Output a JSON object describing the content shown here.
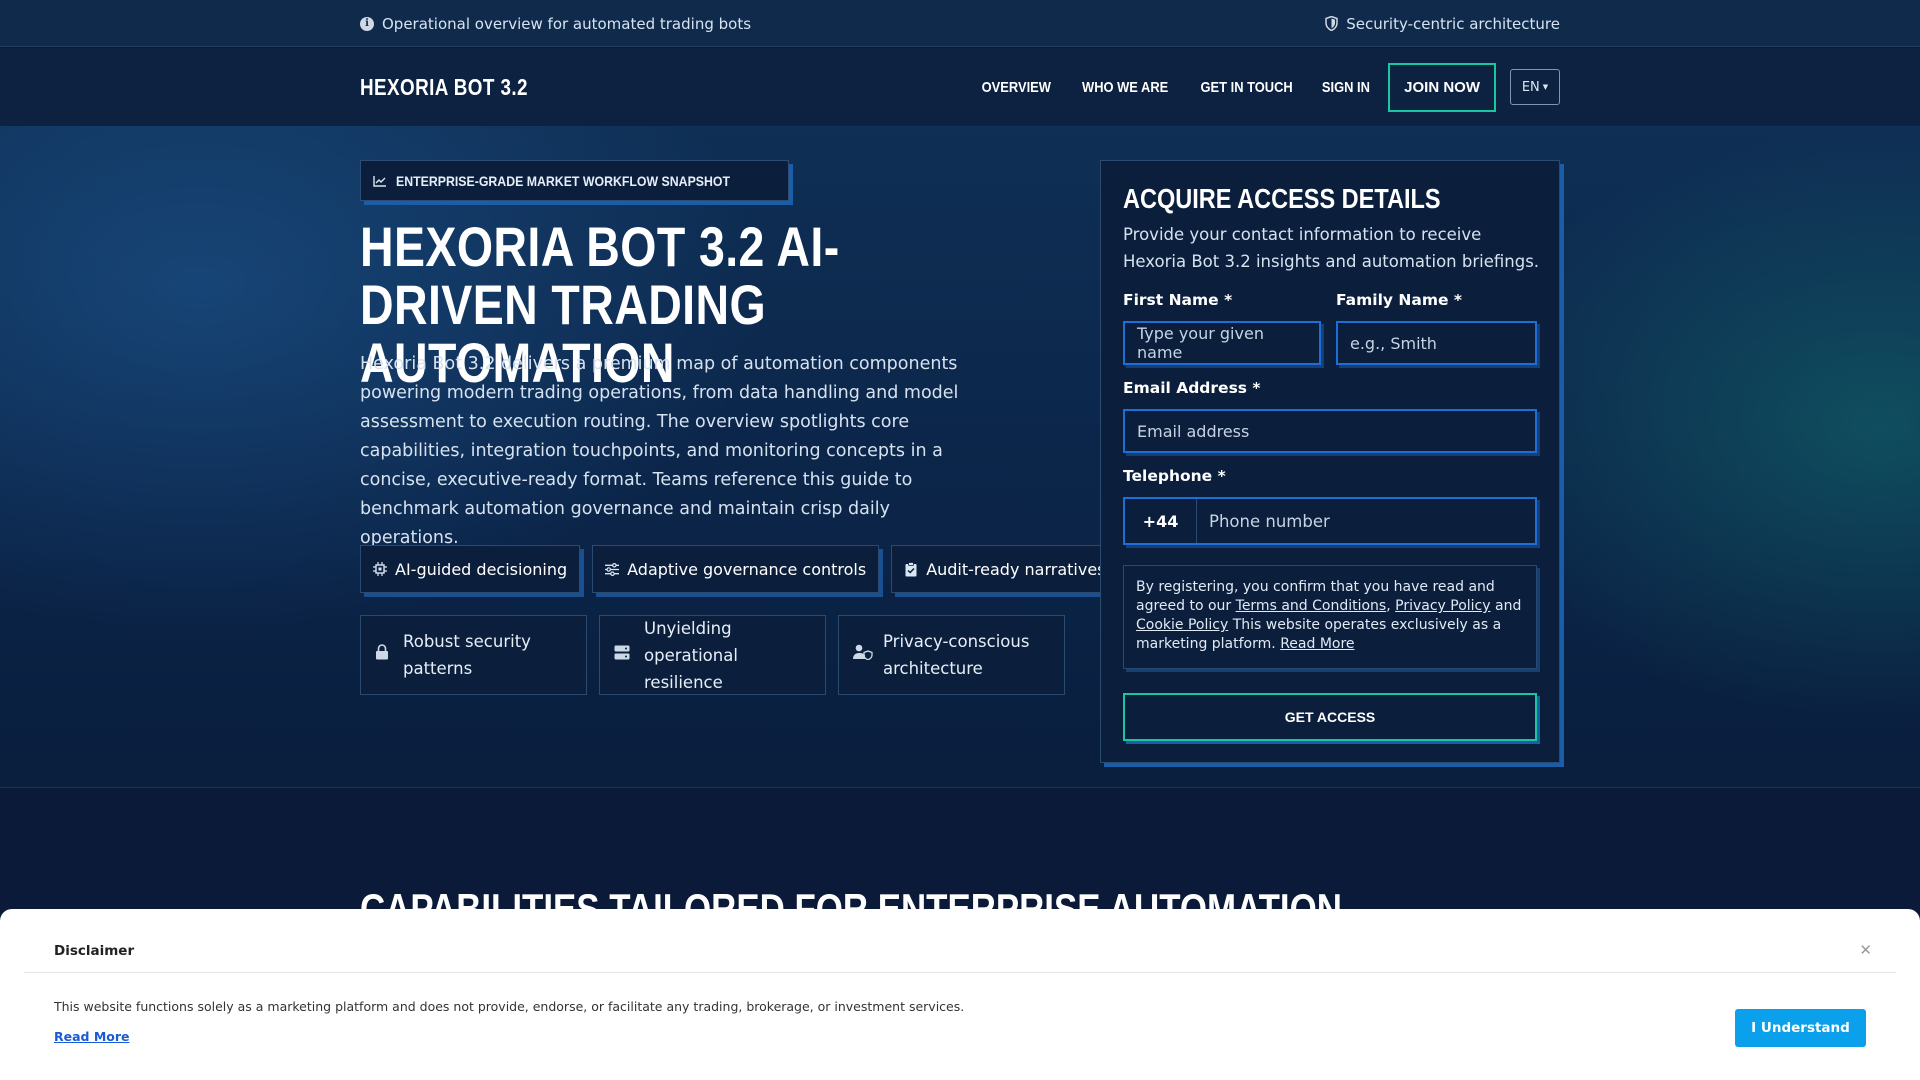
{
  "topbar": {
    "left_text": "Operational overview for automated trading bots",
    "right_text": "Security-centric architecture",
    "left_icon": "info-icon",
    "right_icon": "shield-icon"
  },
  "nav": {
    "brand": "HEXORIA BOT 3.2",
    "links": [
      "OVERVIEW",
      "WHO WE ARE",
      "GET IN TOUCH",
      "SIGN IN"
    ],
    "join_label": "JOIN NOW",
    "lang_label": "EN"
  },
  "hero": {
    "badge_label": "ENTERPRISE-GRADE MARKET WORKFLOW SNAPSHOT",
    "title": "HEXORIA BOT 3.2 AI-DRIVEN TRADING AUTOMATION",
    "description": "Hexoria Bot 3.2 delivers a premium map of automation components powering modern trading operations, from data handling and model assessment to execution routing. The overview spotlights core capabilities, integration touchpoints, and monitoring concepts in a concise, executive-ready format. Teams reference this guide to benchmark automation governance and maintain crisp daily operations.",
    "chips": [
      {
        "label": "AI-guided decisioning",
        "icon": "chip-icon"
      },
      {
        "label": "Adaptive governance controls",
        "icon": "sliders-icon"
      },
      {
        "label": "Audit-ready narratives",
        "icon": "clipboard-check-icon"
      }
    ],
    "cards": [
      {
        "label": "Robust security patterns",
        "icon": "lock-icon"
      },
      {
        "label": "Unyielding operational resilience",
        "icon": "server-icon"
      },
      {
        "label": "Privacy-conscious architecture",
        "icon": "user-shield-icon"
      }
    ]
  },
  "form": {
    "title": "ACQUIRE ACCESS DETAILS",
    "description": "Provide your contact information to receive Hexoria Bot 3.2 insights and automation briefings.",
    "first_name_label": "First Name *",
    "first_name_placeholder": "Type your given name",
    "family_name_label": "Family Name *",
    "family_name_placeholder": "e.g., Smith",
    "email_label": "Email Address *",
    "email_placeholder": "Email address",
    "phone_label": "Telephone *",
    "phone_code": "+44",
    "phone_placeholder": "Phone number",
    "consent_prefix": "By registering, you confirm that you have read and agreed to our",
    "terms_link": "Terms and Conditions",
    "privacy_link": "Privacy Policy",
    "and_text": "and",
    "cookie_link": "Cookie Policy",
    "consent_suffix": "This website operates exclusively as a marketing platform.",
    "read_more": "Read More",
    "submit_label": "GET ACCESS"
  },
  "section": {
    "title": "CAPABILITIES TAILORED FOR ENTERPRISE AUTOMATION"
  },
  "disclaimer": {
    "title": "Disclaimer",
    "text": "This website functions solely as a marketing platform and does not provide, endorse, or facilitate any trading, brokerage, or investment services.",
    "read_more": "Read More",
    "button_label": "I Understand",
    "close_icon": "close-icon"
  },
  "colors": {
    "accent_green": "#18c7a0",
    "accent_blue": "#1e6ed8",
    "button_blue": "#0aa0ec",
    "background": "#0b1a3a"
  }
}
